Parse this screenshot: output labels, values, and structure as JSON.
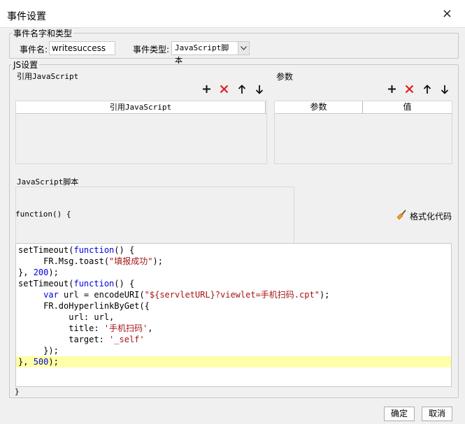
{
  "dialog": {
    "title": "事件设置",
    "close": "×"
  },
  "event_group": {
    "legend": "事件名字和类型",
    "name_label": "事件名:",
    "name_value": "writesuccess",
    "type_label": "事件类型:",
    "type_value": "JavaScript脚本"
  },
  "js_group": {
    "legend": "JS设置",
    "ref_js_label": "引用JavaScript",
    "params_label": "参数",
    "ref_table_header": "引用JavaScript",
    "params_headers": [
      "参数",
      "值"
    ],
    "script_label": "JavaScript脚本",
    "func_signature": "function() {",
    "format_button": "格式化代码",
    "closing_brace": "}"
  },
  "code_lines": [
    "setTimeout(function() {",
    "     FR.Msg.toast(\"填报成功\");",
    "}, 200);",
    "setTimeout(function() {",
    "     var url = encodeURI(\"${servletURL}?viewlet=手机扫码.cpt\");",
    "     FR.doHyperlinkByGet({",
    "          url: url,",
    "          title: '手机扫码',",
    "          target: '_self'",
    "     });",
    "}, 500);"
  ],
  "footer": {
    "ok": "确定",
    "cancel": "取消"
  },
  "colors": {
    "keyword": "#0000e0",
    "string": "#a31515",
    "highlight": "#ffffa8",
    "delete": "#e02020"
  }
}
